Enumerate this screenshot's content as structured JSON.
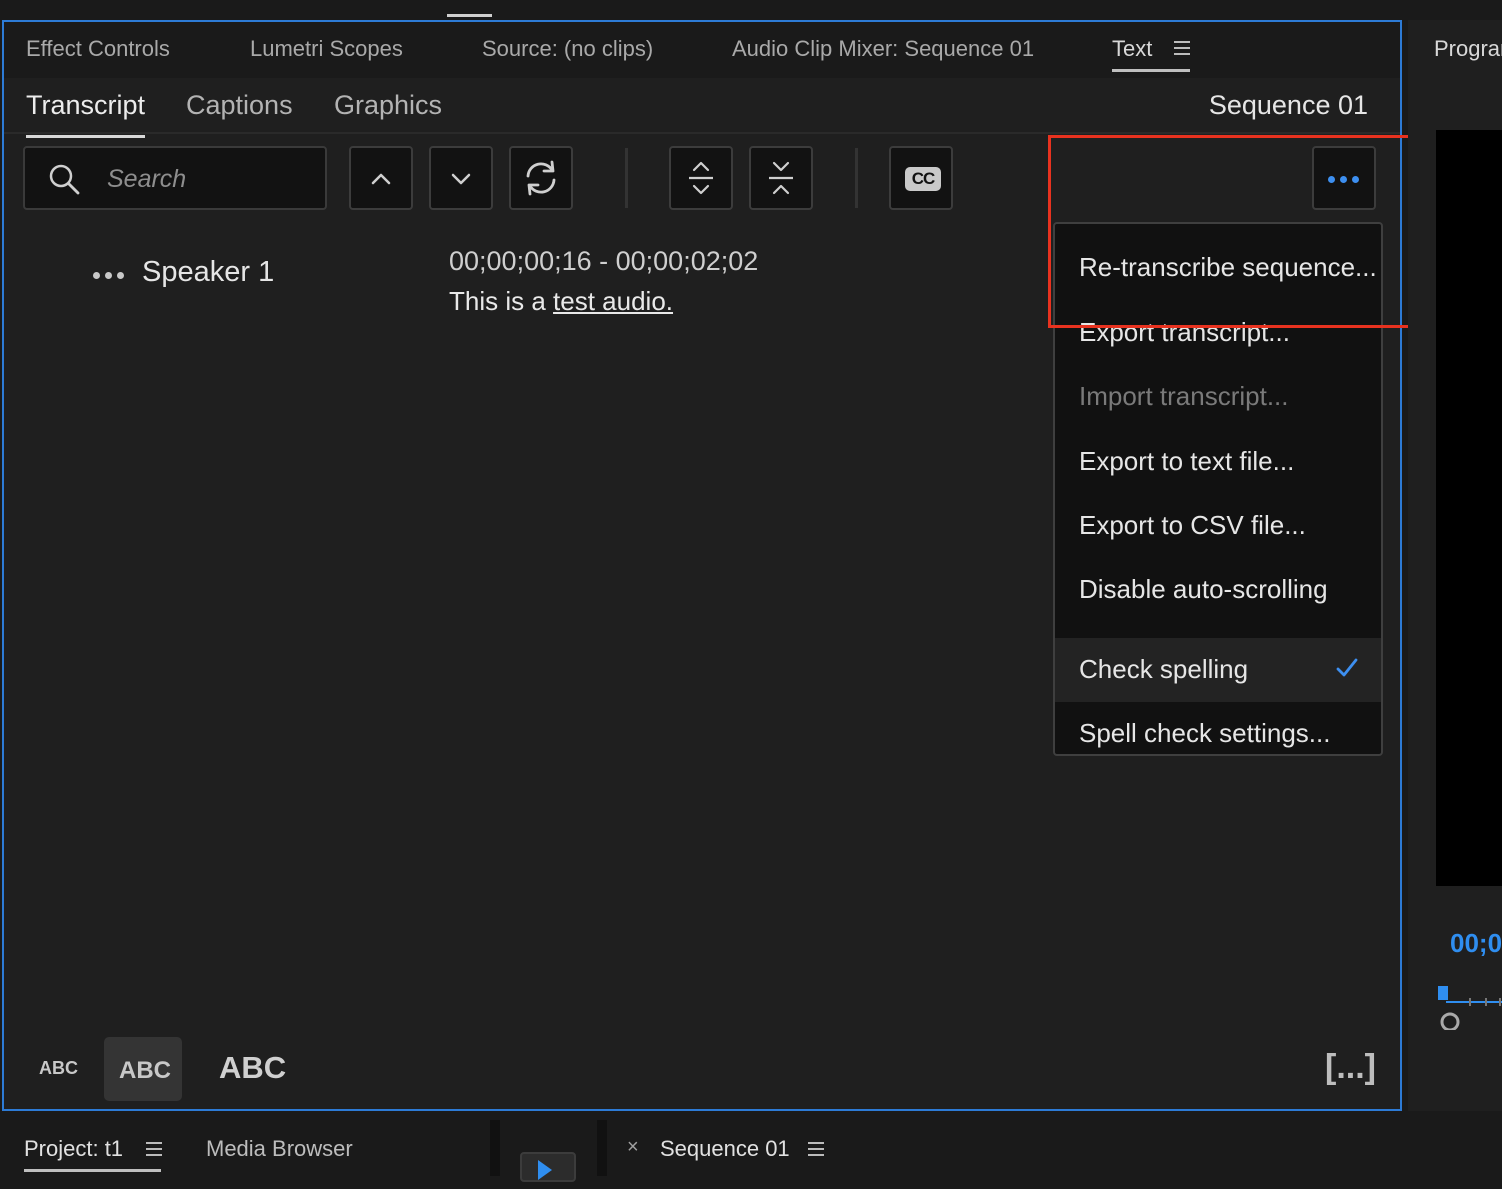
{
  "panel_tabs": {
    "effect_controls": "Effect Controls",
    "lumetri_scopes": "Lumetri Scopes",
    "source": "Source: (no clips)",
    "audio_clip_mixer": "Audio Clip Mixer: Sequence 01",
    "text": "Text"
  },
  "subtabs": {
    "transcript": "Transcript",
    "captions": "Captions",
    "graphics": "Graphics",
    "sequence_name": "Sequence 01"
  },
  "search": {
    "placeholder": "Search"
  },
  "toolbar": {
    "cc_label": "CC"
  },
  "transcript": {
    "speaker": "Speaker 1",
    "timecode": "00;00;00;16 - 00;00;02;02",
    "text_prefix": "This is a ",
    "text_link": "test audio."
  },
  "menu": {
    "items": [
      {
        "label": "Re-transcribe sequence...",
        "state": "enabled"
      },
      {
        "label": "Export transcript...",
        "state": "enabled"
      },
      {
        "label": "Import transcript...",
        "state": "disabled"
      },
      {
        "label": "Export to text file...",
        "state": "enabled"
      },
      {
        "label": "Export to CSV file...",
        "state": "enabled"
      },
      {
        "label": "Disable auto-scrolling",
        "state": "enabled"
      },
      {
        "label": "Check spelling",
        "state": "checked"
      },
      {
        "label": "Spell check settings...",
        "state": "enabled"
      }
    ]
  },
  "text_size": {
    "small": "ABC",
    "medium": "ABC",
    "large": "ABC"
  },
  "bracket_button": "[...]",
  "program": {
    "title": "Program",
    "timecode": "00;0"
  },
  "bottom": {
    "project": "Project: t1",
    "media_browser": "Media Browser",
    "sequence": "Sequence 01",
    "close_symbol": "×"
  },
  "colors": {
    "accent": "#2d7bd6",
    "highlight": "#e8321f",
    "check": "#3d8ff0"
  }
}
